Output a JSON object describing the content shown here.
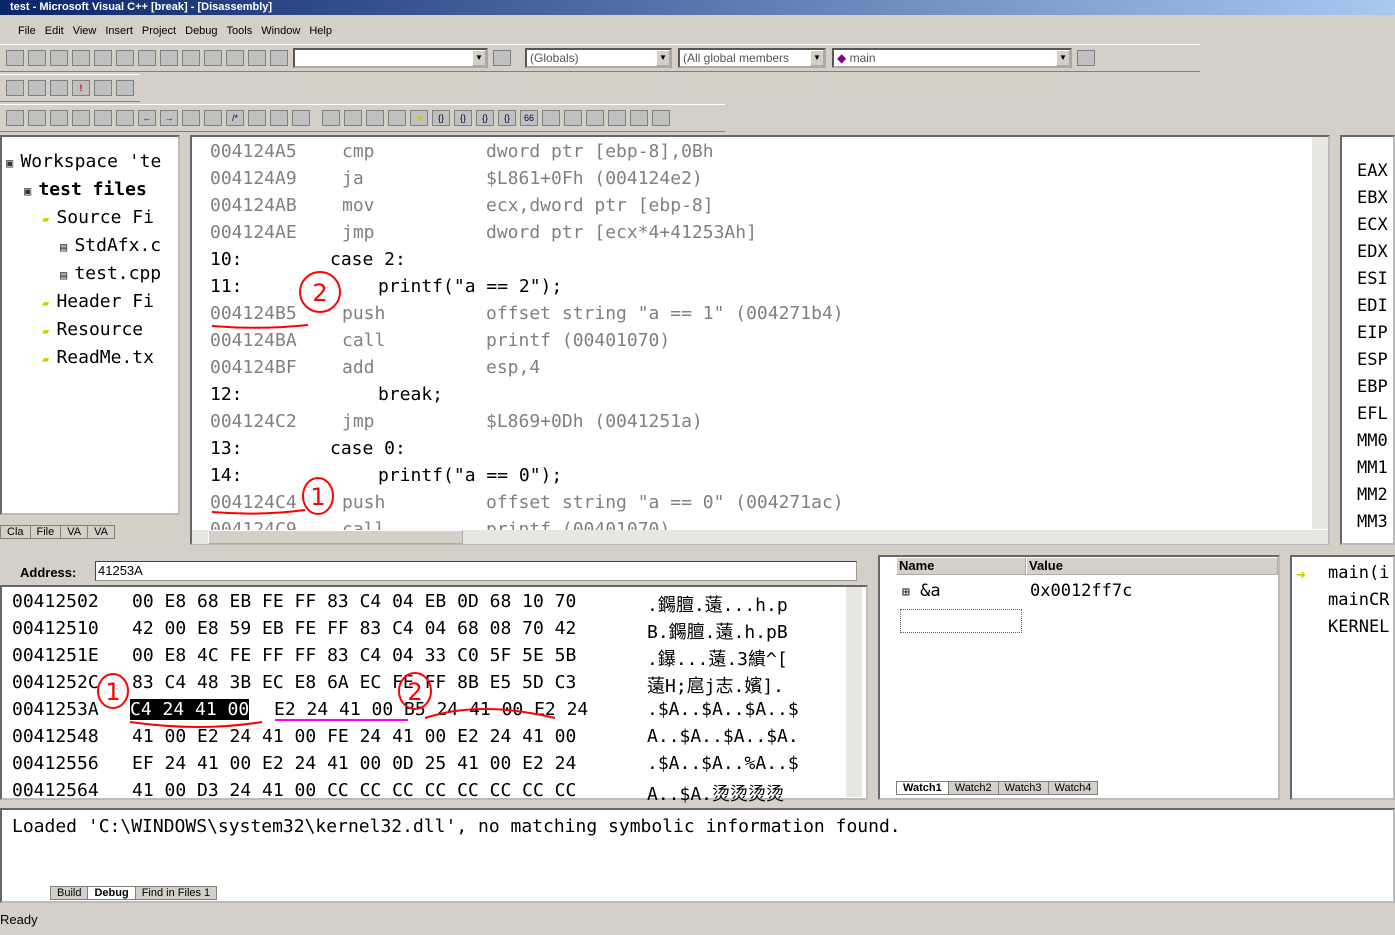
{
  "window": {
    "title": "test - Microsoft Visual C++ [break] - [Disassembly]"
  },
  "menu": [
    "File",
    "Edit",
    "View",
    "Insert",
    "Project",
    "Debug",
    "Tools",
    "Window",
    "Help"
  ],
  "toolbar": {
    "find_value": "",
    "globals": "(Globals)",
    "members": "(All global members",
    "function": "main"
  },
  "workspace": {
    "items": [
      {
        "label": "Workspace 'te",
        "indent": 0
      },
      {
        "label": "test files",
        "indent": 1,
        "bold": true
      },
      {
        "label": "Source Fi",
        "indent": 2
      },
      {
        "label": "StdAfx.c",
        "indent": 3
      },
      {
        "label": "test.cpp",
        "indent": 3
      },
      {
        "label": "Header Fi",
        "indent": 2
      },
      {
        "label": "Resource",
        "indent": 2
      },
      {
        "label": "ReadMe.tx",
        "indent": 2
      }
    ],
    "tabs": [
      "Cla",
      "File",
      "VA",
      "VA"
    ]
  },
  "disassembly": [
    {
      "t": "asm",
      "addr": "004124A5",
      "op": "cmp",
      "arg": "dword ptr [ebp-8],0Bh"
    },
    {
      "t": "asm",
      "addr": "004124A9",
      "op": "ja",
      "arg": "$L861+0Fh (004124e2)"
    },
    {
      "t": "asm",
      "addr": "004124AB",
      "op": "mov",
      "arg": "ecx,dword ptr [ebp-8]"
    },
    {
      "t": "asm",
      "addr": "004124AE",
      "op": "jmp",
      "arg": "dword ptr [ecx*4+41253Ah]"
    },
    {
      "t": "src",
      "line": "10:",
      "code": "case 2:",
      "ind": 0
    },
    {
      "t": "src",
      "line": "11:",
      "code": "printf(\"a == 2\");",
      "ind": 1
    },
    {
      "t": "asm",
      "addr": "004124B5",
      "op": "push",
      "arg": "offset string \"a == 1\" (004271b4)"
    },
    {
      "t": "asm",
      "addr": "004124BA",
      "op": "call",
      "arg": "printf (00401070)"
    },
    {
      "t": "asm",
      "addr": "004124BF",
      "op": "add",
      "arg": "esp,4"
    },
    {
      "t": "src",
      "line": "12:",
      "code": "break;",
      "ind": 1
    },
    {
      "t": "asm",
      "addr": "004124C2",
      "op": "jmp",
      "arg": "$L869+0Dh (0041251a)"
    },
    {
      "t": "src",
      "line": "13:",
      "code": "case 0:",
      "ind": 0
    },
    {
      "t": "src",
      "line": "14:",
      "code": "printf(\"a == 0\");",
      "ind": 1
    },
    {
      "t": "asm",
      "addr": "004124C4",
      "op": "push",
      "arg": "offset string \"a == 0\" (004271ac)"
    },
    {
      "t": "asm",
      "addr": "004124C9",
      "op": "call",
      "arg": "printf (00401070)"
    }
  ],
  "registers": [
    "EAX",
    "EBX",
    "ECX",
    "EDX",
    "ESI",
    "EDI",
    "EIP",
    "ESP",
    "EBP",
    "EFL",
    "MM0",
    "MM1",
    "MM2",
    "MM3"
  ],
  "memory": {
    "address_label": "Address:",
    "address_value": "41253A",
    "rows": [
      {
        "a": "00412502",
        "b": "00 E8 68 EB FE FF 83 C4 04 EB 0D 68 10 70",
        "c": ".鐊膻.薳...h.p"
      },
      {
        "a": "00412510",
        "b": "42 00 E8 59 EB FE FF 83 C4 04 68 08 70 42",
        "c": "B.鐊膻.薳.h.pB"
      },
      {
        "a": "0041251E",
        "b": "00 E8 4C FE FF FF 83 C4 04 33 C0 5F 5E 5B",
        "c": ".鑤...薳.3繢^["
      },
      {
        "a": "0041252C",
        "b": "83 C4 48 3B EC E8 6A EC FE FF 8B E5 5D C3",
        "c": "薳H;扈j志.嬪]."
      },
      {
        "a": "0041253A",
        "b": "C4 24 41 00 E2 24 41 00 B5 24 41 00 E2 24",
        "c": ".$A..$A..$A..$",
        "sel": "C4 24 41 00"
      },
      {
        "a": "00412548",
        "b": "41 00 E2 24 41 00 FE 24 41 00 E2 24 41 00",
        "c": "A..$A..$A..$A."
      },
      {
        "a": "00412556",
        "b": "EF 24 41 00 E2 24 41 00 0D 25 41 00 E2 24",
        "c": ".$A..$A..%A..$"
      },
      {
        "a": "00412564",
        "b": "41 00 D3 24 41 00 CC CC CC CC CC CC CC CC",
        "c": "A..$A.烫烫烫烫"
      }
    ]
  },
  "watch": {
    "headers": [
      "Name",
      "Value"
    ],
    "rows": [
      {
        "name": "&a",
        "value": "0x0012ff7c"
      }
    ],
    "tabs": [
      "Watch1",
      "Watch2",
      "Watch3",
      "Watch4"
    ]
  },
  "callstack": [
    "main(i",
    "mainCR",
    "KERNEL"
  ],
  "output": {
    "text": "Loaded 'C:\\WINDOWS\\system32\\kernel32.dll', no matching symbolic information found.",
    "tabs": [
      "Build",
      "Debug",
      "Find in Files 1"
    ]
  },
  "status": "Ready",
  "annotations": {
    "one": "1",
    "two": "2",
    "color": "#ff0000",
    "alt_color": "#ff00ff"
  }
}
